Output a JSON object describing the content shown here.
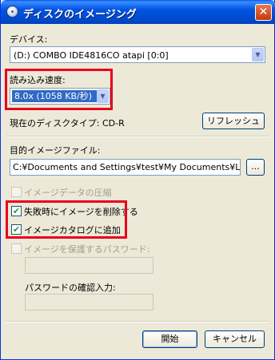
{
  "window": {
    "title": "ディスクのイメージング",
    "close_glyph": "✕"
  },
  "device": {
    "label": "デバイス:",
    "selected": "(D:) COMBO IDE4816CO atapi [0:0]"
  },
  "speed": {
    "label": "読み込み速度:",
    "selected": "8.0x (1058 KB/秒)"
  },
  "disc_type": {
    "text": "現在のディスクタイプ: CD-R"
  },
  "refresh_button": "リフレッシュ",
  "target_file": {
    "label": "目的イメージファイル:",
    "value": "C:¥Documents and Settings¥test¥My Documents¥LOGICAL",
    "browse_label": "..."
  },
  "options": {
    "compress": {
      "label": "イメージデータの圧縮",
      "checked": false,
      "enabled": false
    },
    "delete_on_fail": {
      "label": "失敗時にイメージを削除する",
      "checked": true,
      "enabled": true
    },
    "add_to_catalog": {
      "label": "イメージカタログに追加",
      "checked": true,
      "enabled": true
    },
    "protect": {
      "label": "イメージを保護するパスワード:",
      "checked": false,
      "enabled": false
    }
  },
  "confirm_password": {
    "label": "パスワードの確認入力:"
  },
  "buttons": {
    "start": "開始",
    "cancel": "キャンセル"
  },
  "check_glyph": "✔",
  "arrow_glyph": "▼",
  "colors": {
    "titlebar": "#0054e3",
    "highlight_box": "#e8001c",
    "selection": "#316ac5"
  }
}
